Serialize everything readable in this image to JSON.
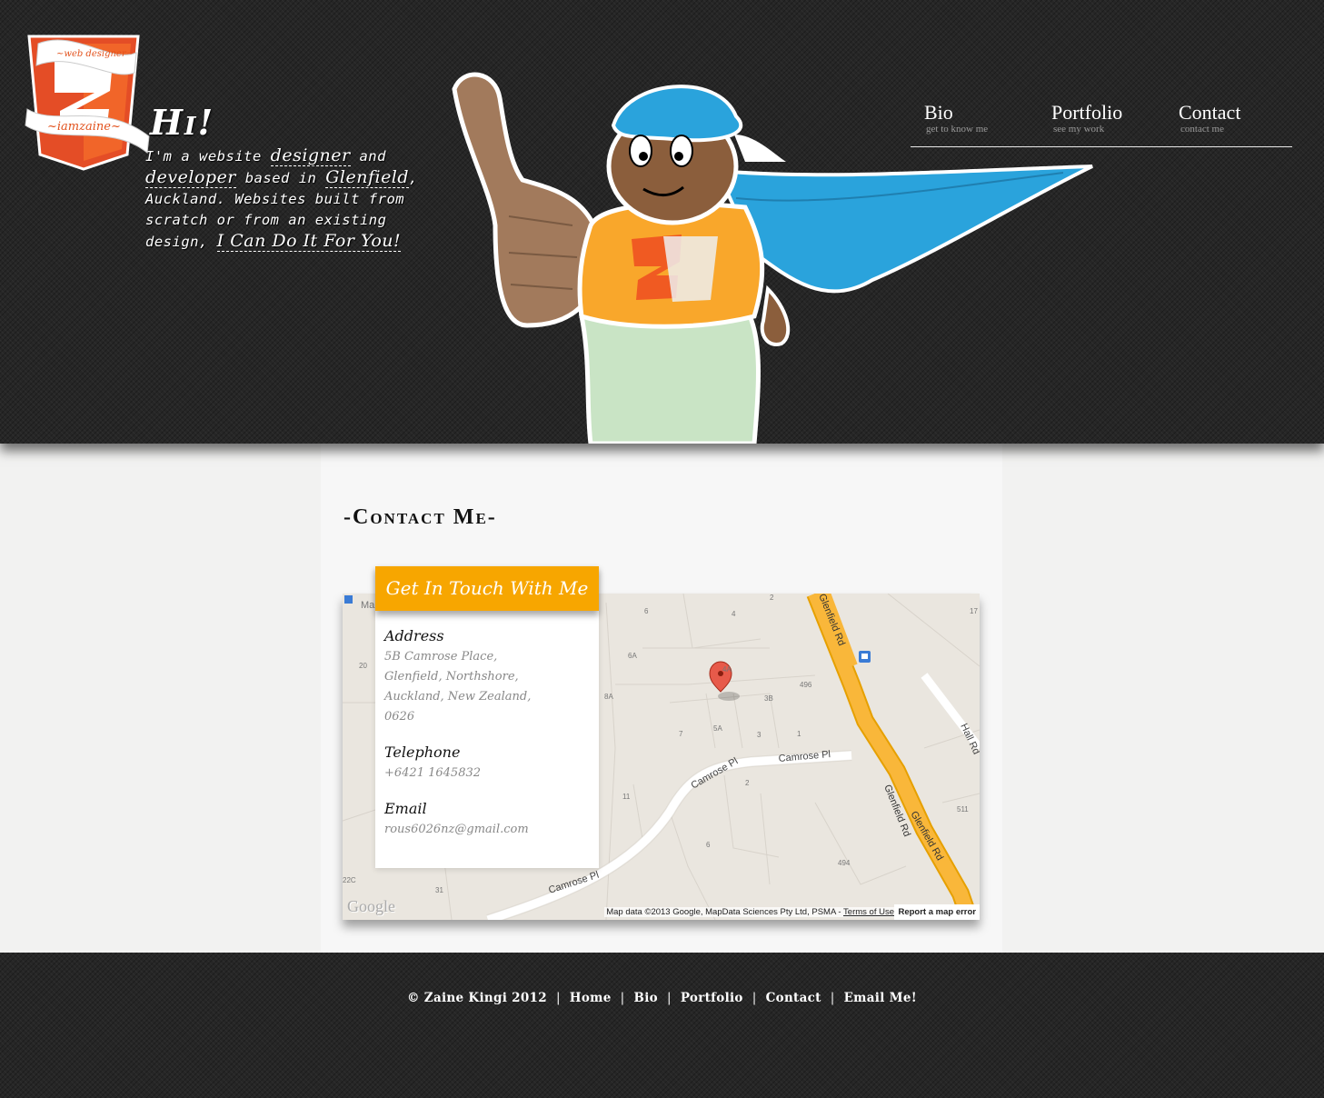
{
  "brand": {
    "logo_banner_top": "~web designer~",
    "logo_banner_bottom": "~iamzaine~",
    "accent_color": "#e2521d",
    "shield_color": "#e44d26",
    "orange": "#f7a600"
  },
  "hero": {
    "greeting": "Hi!",
    "intro": {
      "p1": "I'm a website ",
      "w1": "designer",
      "p2": " and ",
      "w2": "developer",
      "p3": " based in ",
      "w3": "Glenfield",
      "p4": ", Auckland. Websites built from scratch or from an existing design, ",
      "w4": "I Can Do It For You!"
    }
  },
  "nav": {
    "items": [
      {
        "label": "Bio",
        "sub": "get to know me"
      },
      {
        "label": "Portfolio",
        "sub": "see my work"
      },
      {
        "label": "Contact",
        "sub": "contact me"
      }
    ]
  },
  "contact": {
    "title": "-Contact Me-",
    "card_title": "Get In Touch With Me",
    "address_label": "Address",
    "address_lines": [
      "5B Camrose Place,",
      "Glenfield, Northshore,",
      "Auckland, New Zealand,",
      "0626"
    ],
    "telephone_label": "Telephone",
    "telephone": "+6421 1645832",
    "email_label": "Email",
    "email": "rous6026nz@gmail.com"
  },
  "map": {
    "roads": [
      "Glenfield Rd",
      "Glenfield Rd",
      "Glenfield Rd",
      "Camrose Pl",
      "Camrose Pl",
      "Camrose Pl",
      "Hall Rd"
    ],
    "house_numbers": [
      "6",
      "4",
      "2",
      "17",
      "6A",
      "4A",
      "496",
      "20",
      "8A",
      "3B",
      "7",
      "5A",
      "3",
      "1",
      "2",
      "11",
      "511",
      "6",
      "494",
      "22C",
      "31",
      "Ma"
    ],
    "attribution_prefix": "Map data ©2013 Google, MapData Sciences Pty Ltd, PSMA - ",
    "terms": "Terms of Use",
    "report": "Report a map error",
    "logo": "Google"
  },
  "footer": {
    "copyright": "© Zaine Kingi 2012",
    "links": [
      "Home",
      "Bio",
      "Portfolio",
      "Contact",
      "Email Me!"
    ],
    "separator": "|"
  }
}
